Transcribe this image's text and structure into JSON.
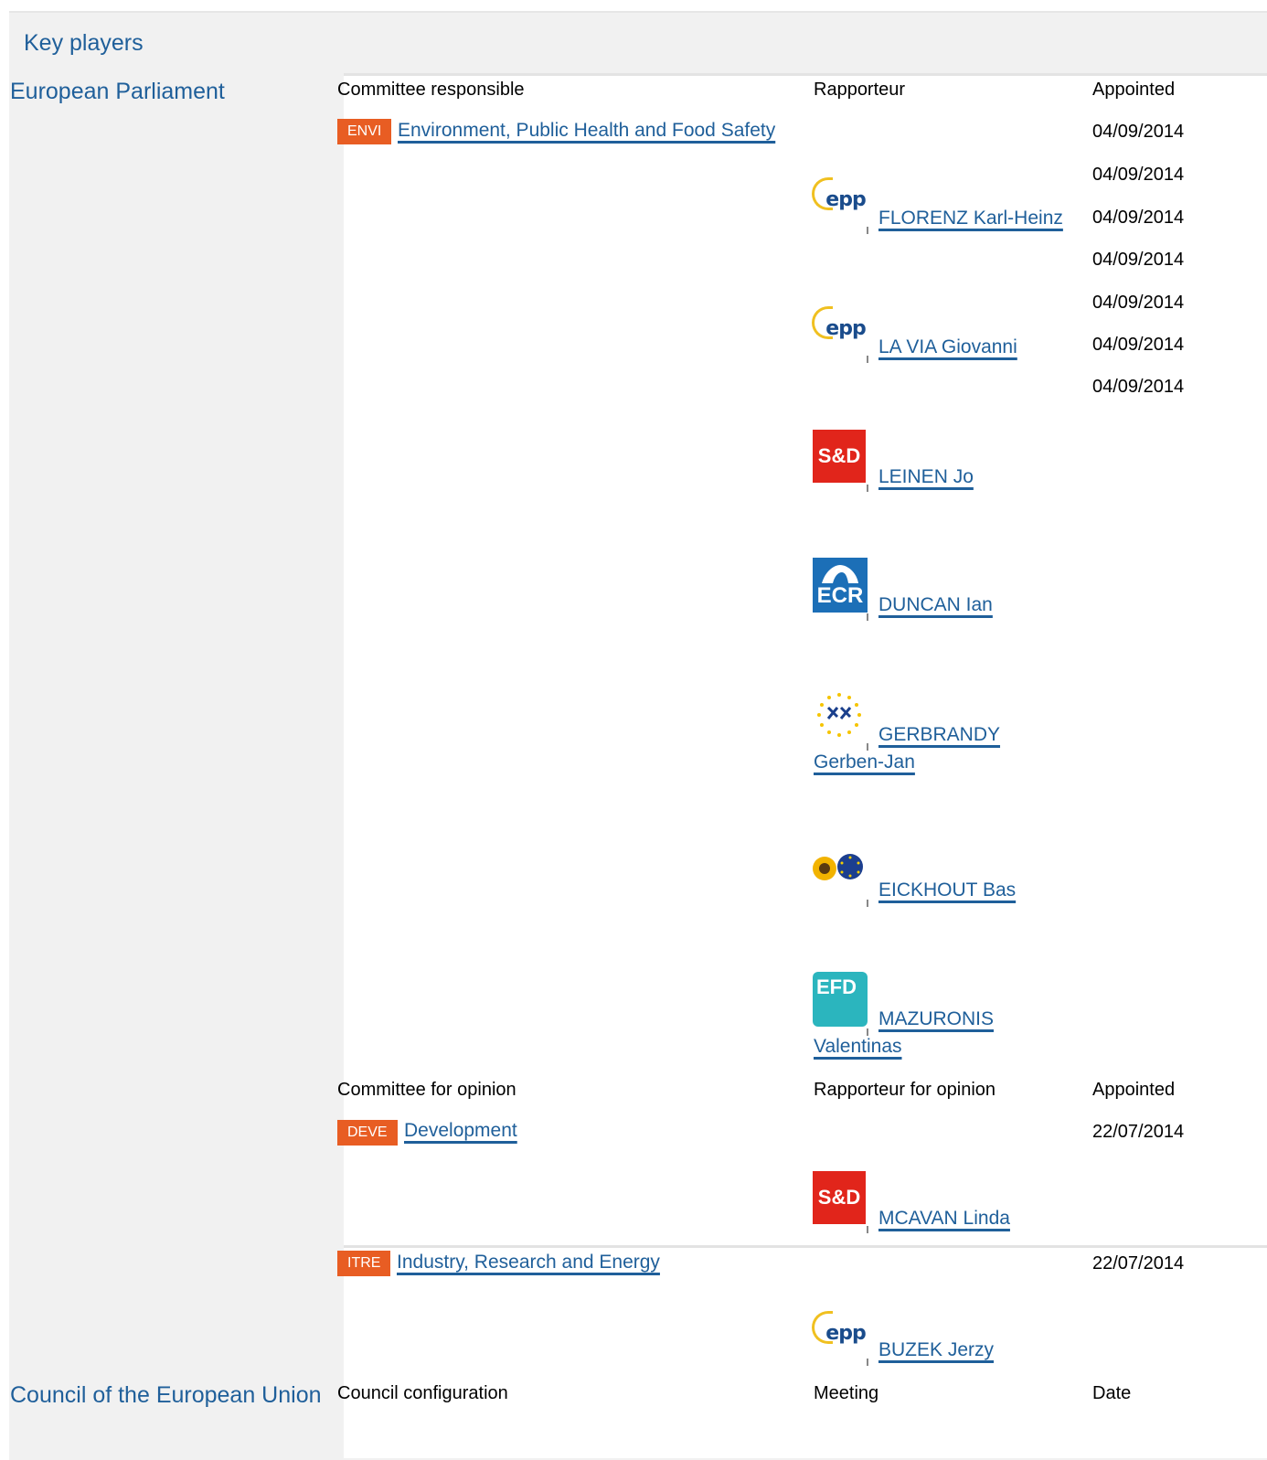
{
  "title": "Key players",
  "parliament": {
    "name": "European Parliament",
    "responsible_header": {
      "committee": "Committee responsible",
      "rapporteur": "Rapporteur",
      "appointed": "Appointed"
    },
    "responsible": {
      "code": "ENVI",
      "name": "Environment, Public Health and Food Safety",
      "dates": [
        "04/09/2014",
        "04/09/2014",
        "04/09/2014",
        "04/09/2014",
        "04/09/2014",
        "04/09/2014",
        "04/09/2014"
      ],
      "rapporteurs": [
        {
          "line1": "FLORENZ Karl-Heinz",
          "line2": "",
          "group": "epp-logo"
        },
        {
          "line1": "LA VIA Giovanni",
          "line2": "",
          "group": "epp-logo"
        },
        {
          "line1": "LEINEN Jo",
          "line2": "",
          "group": "sd-logo"
        },
        {
          "line1": "DUNCAN Ian",
          "line2": "",
          "group": "ecr-logo"
        },
        {
          "line1": "GERBRANDY",
          "line2": "Gerben-Jan",
          "group": "alde-logo"
        },
        {
          "line1": "EICKHOUT Bas",
          "line2": "",
          "group": "greens-efa-logo"
        },
        {
          "line1": "MAZURONIS",
          "line2": "Valentinas",
          "group": "efd-logo"
        }
      ]
    },
    "opinion_header": {
      "committee": "Committee for opinion",
      "rapporteur": "Rapporteur for opinion",
      "appointed": "Appointed"
    },
    "opinions": [
      {
        "code": "DEVE",
        "name": "Development",
        "date": "22/07/2014",
        "rapporteur": "MCAVAN Linda",
        "group": "sd-logo"
      },
      {
        "code": "ITRE",
        "name": "Industry, Research and Energy",
        "date": "22/07/2014",
        "rapporteur": "BUZEK Jerzy",
        "group": "epp-logo"
      }
    ],
    "logo_text": {
      "epp": "epp",
      "sd": "S&D",
      "ecr": "ECR",
      "efd": "EFD"
    }
  },
  "council": {
    "name": "Council of the European Union",
    "header": {
      "configuration": "Council configuration",
      "meeting": "Meeting",
      "date": "Date"
    }
  }
}
